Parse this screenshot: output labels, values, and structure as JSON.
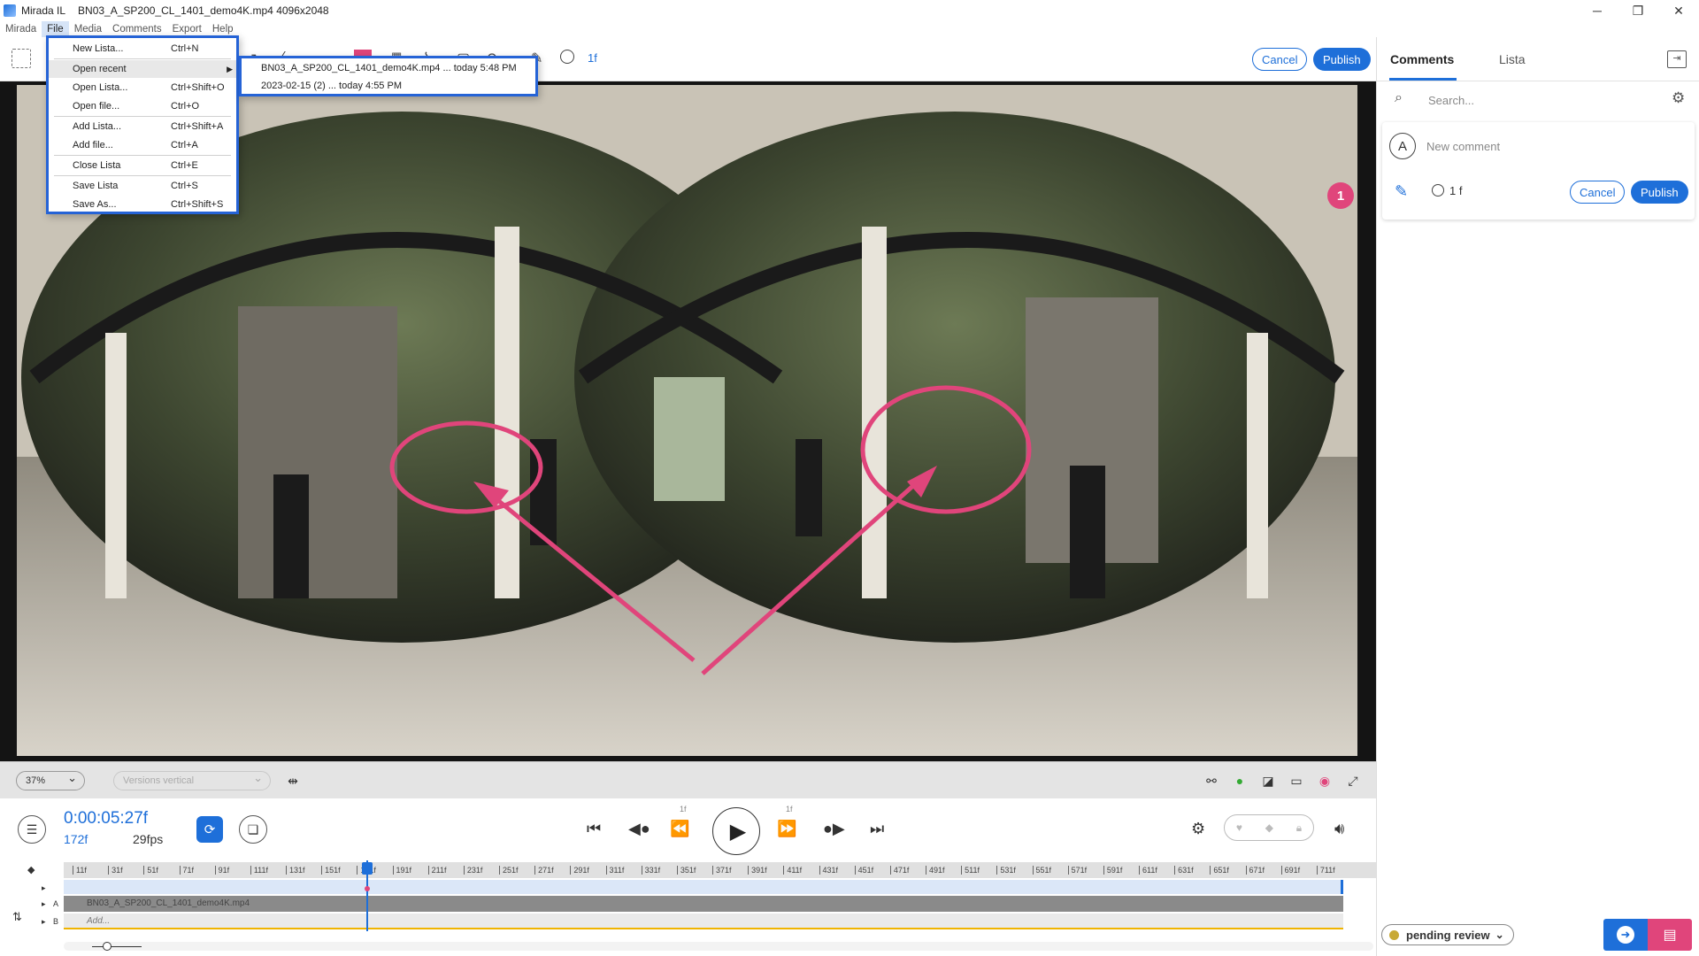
{
  "window": {
    "app_name": "Mirada IL",
    "file_title": "BN03_A_SP200_CL_1401_demo4K.mp4 4096x2048",
    "controls": [
      "─",
      "❐",
      "✕"
    ]
  },
  "menubar": [
    "Mirada",
    "File",
    "Media",
    "Comments",
    "Export",
    "Help"
  ],
  "file_menu": {
    "items": [
      {
        "label": "New Lista...",
        "shortcut": "Ctrl+N"
      },
      {
        "label": "Open recent",
        "shortcut": ""
      },
      {
        "label": "Open Lista...",
        "shortcut": "Ctrl+Shift+O"
      },
      {
        "label": "Open file...",
        "shortcut": "Ctrl+O"
      },
      {
        "label": "Add Lista...",
        "shortcut": "Ctrl+Shift+A"
      },
      {
        "label": "Add file...",
        "shortcut": "Ctrl+A"
      },
      {
        "label": "Close Lista",
        "shortcut": "Ctrl+E"
      },
      {
        "label": "Save Lista",
        "shortcut": "Ctrl+S"
      },
      {
        "label": "Save As...",
        "shortcut": "Ctrl+Shift+S"
      }
    ],
    "recent": [
      "BN03_A_SP200_CL_1401_demo4K.mp4 ... today 5:48 PM",
      "2023-02-15 (2) ... today 4:55 PM"
    ]
  },
  "toolbar": {
    "frame_label": "1f",
    "cancel_label": "Cancel",
    "publish_label": "Publish",
    "annotation_color": "#e0457b"
  },
  "viewer": {
    "comment_marker": "1",
    "zoom": "37%",
    "versions_placeholder": "Versions vertical"
  },
  "transport": {
    "timecode": "0:00:05:27f",
    "frame": "172f",
    "fps": "29fps",
    "step_back_label": "1f",
    "step_fwd_label": "1f"
  },
  "timeline": {
    "ticks": [
      "11f",
      "31f",
      "51f",
      "71f",
      "91f",
      "111f",
      "131f",
      "151f",
      "171f",
      "191f",
      "211f",
      "231f",
      "251f",
      "271f",
      "291f",
      "311f",
      "331f",
      "351f",
      "371f",
      "391f",
      "411f",
      "431f",
      "451f",
      "471f",
      "491f",
      "511f",
      "531f",
      "551f",
      "571f",
      "591f",
      "611f",
      "631f",
      "651f",
      "671f",
      "691f",
      "711f"
    ],
    "track_a_label": "A",
    "track_b_label": "B",
    "track_a_clip": "BN03_A_SP200_CL_1401_demo4K.mp4",
    "track_b_clip": "Add..."
  },
  "panel": {
    "tabs": [
      "Comments",
      "Lista"
    ],
    "search_placeholder": "Search...",
    "avatar_letter": "A",
    "comment_placeholder": "New comment",
    "frame_label": "1 f",
    "cancel_label": "Cancel",
    "publish_label": "Publish",
    "status": "pending review",
    "accent": "#1e6fd9"
  }
}
